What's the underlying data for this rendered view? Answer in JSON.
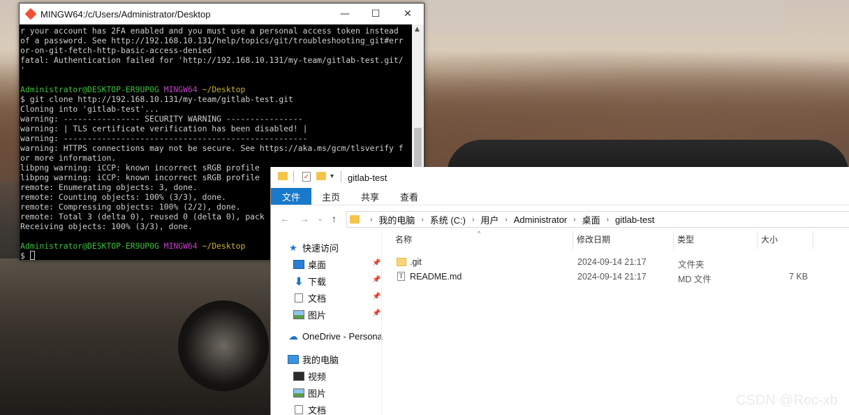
{
  "terminal": {
    "title": "MINGW64:/c/Users/Administrator/Desktop",
    "controls": {
      "minimize": "—",
      "maximize": "☐",
      "close": "✕"
    },
    "lines": [
      {
        "segments": [
          {
            "t": "r your account has 2FA enabled and you must use a personal access token instead",
            "c": ""
          }
        ]
      },
      {
        "segments": [
          {
            "t": "of a password. See http://192.168.10.131/help/topics/git/troubleshooting_git#err",
            "c": ""
          }
        ]
      },
      {
        "segments": [
          {
            "t": "or-on-git-fetch-http-basic-access-denied",
            "c": ""
          }
        ]
      },
      {
        "segments": [
          {
            "t": "fatal: Authentication failed for 'http://192.168.10.131/my-team/gitlab-test.git/",
            "c": ""
          }
        ]
      },
      {
        "segments": [
          {
            "t": "'",
            "c": ""
          }
        ]
      },
      {
        "segments": [
          {
            "t": "",
            "c": ""
          }
        ]
      },
      {
        "segments": [
          {
            "t": "Administrator@DESKTOP-ER9UP0G ",
            "c": "c-green"
          },
          {
            "t": "MINGW64 ",
            "c": "c-mag"
          },
          {
            "t": "~/Desktop",
            "c": "c-yel"
          }
        ]
      },
      {
        "segments": [
          {
            "t": "$ git clone http://192.168.10.131/my-team/gitlab-test.git",
            "c": ""
          }
        ]
      },
      {
        "segments": [
          {
            "t": "Cloning into 'gitlab-test'...",
            "c": ""
          }
        ]
      },
      {
        "segments": [
          {
            "t": "warning: ---------------- SECURITY WARNING ----------------",
            "c": ""
          }
        ]
      },
      {
        "segments": [
          {
            "t": "warning: | TLS certificate verification has been disabled! |",
            "c": ""
          }
        ]
      },
      {
        "segments": [
          {
            "t": "warning: ---------------------------------------------------",
            "c": ""
          }
        ]
      },
      {
        "segments": [
          {
            "t": "warning: HTTPS connections may not be secure. See https://aka.ms/gcm/tlsverify f",
            "c": ""
          }
        ]
      },
      {
        "segments": [
          {
            "t": "or more information.",
            "c": ""
          }
        ]
      },
      {
        "segments": [
          {
            "t": "libpng warning: iCCP: known incorrect sRGB profile",
            "c": ""
          }
        ]
      },
      {
        "segments": [
          {
            "t": "libpng warning: iCCP: known incorrect sRGB profile",
            "c": ""
          }
        ]
      },
      {
        "segments": [
          {
            "t": "remote: Enumerating objects: 3, done.",
            "c": ""
          }
        ]
      },
      {
        "segments": [
          {
            "t": "remote: Counting objects: 100% (3/3), done.",
            "c": ""
          }
        ]
      },
      {
        "segments": [
          {
            "t": "remote: Compressing objects: 100% (2/2), done.",
            "c": ""
          }
        ]
      },
      {
        "segments": [
          {
            "t": "remote: Total 3 (delta 0), reused 0 (delta 0), pack",
            "c": ""
          }
        ]
      },
      {
        "segments": [
          {
            "t": "Receiving objects: 100% (3/3), done.",
            "c": ""
          }
        ]
      },
      {
        "segments": [
          {
            "t": "",
            "c": ""
          }
        ]
      },
      {
        "segments": [
          {
            "t": "Administrator@DESKTOP-ER9UP0G ",
            "c": "c-green"
          },
          {
            "t": "MINGW64 ",
            "c": "c-mag"
          },
          {
            "t": "~/Desktop",
            "c": "c-yel"
          }
        ]
      },
      {
        "segments": [
          {
            "t": "$ ",
            "c": ""
          }
        ],
        "cursor": true
      }
    ]
  },
  "explorer": {
    "title": "gitlab-test",
    "quick_access_dropdown": "▾",
    "ribbon_tabs": [
      "文件",
      "主页",
      "共享",
      "查看"
    ],
    "nav_buttons": {
      "back": "←",
      "forward": "→",
      "recent": "⌄",
      "up": "↑"
    },
    "breadcrumb": [
      "我的电脑",
      "系统 (C:)",
      "用户",
      "Administrator",
      "桌面",
      "gitlab-test"
    ],
    "breadcrumb_separator": "›",
    "sidebar": [
      {
        "label": "快速访问",
        "icon": "star-icon",
        "pinned": false
      },
      {
        "label": "桌面",
        "icon": "desktop-icon",
        "pinned": true
      },
      {
        "label": "下载",
        "icon": "download-icon",
        "pinned": true
      },
      {
        "label": "文档",
        "icon": "document-icon",
        "pinned": true
      },
      {
        "label": "图片",
        "icon": "picture-icon",
        "pinned": true
      },
      {
        "label": "OneDrive - Persona",
        "icon": "cloud-icon",
        "pinned": false
      },
      {
        "label": "我的电脑",
        "icon": "computer-icon",
        "pinned": false
      },
      {
        "label": "视频",
        "icon": "video-icon",
        "pinned": false
      },
      {
        "label": "图片",
        "icon": "picture-icon",
        "pinned": false
      },
      {
        "label": "文档",
        "icon": "document-icon",
        "pinned": false
      }
    ],
    "pin_glyph": "📌",
    "columns": {
      "name": "名称",
      "modified": "修改日期",
      "type": "类型",
      "size": "大小"
    },
    "sort_indicator": "^",
    "files": [
      {
        "name": ".git",
        "icon": "folder-icon",
        "modified": "2024-09-14 21:17",
        "type": "文件夹",
        "size": ""
      },
      {
        "name": "README.md",
        "icon": "text-file-icon",
        "modified": "2024-09-14 21:17",
        "type": "MD 文件",
        "size": "7 KB"
      }
    ]
  },
  "watermark": "CSDN @Roc-xb",
  "colors": {
    "ribbon_active": "#1979ca",
    "terminal_bg": "#000000",
    "prompt_user": "#3fbf3f",
    "prompt_host": "#c33ec3",
    "prompt_path": "#c8b232"
  }
}
